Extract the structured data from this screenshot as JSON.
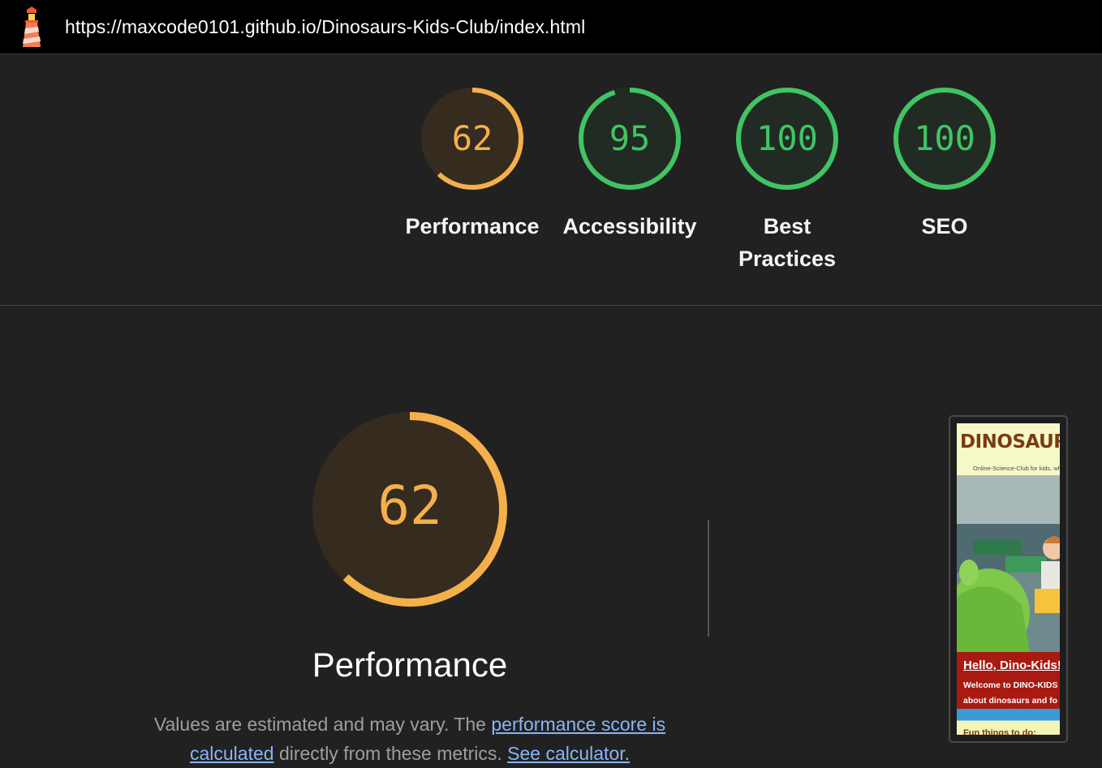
{
  "topbar": {
    "url": "https://maxcode0101.github.io/Dinosaurs-Kids-Club/index.html",
    "logo_icon": "lighthouse-icon"
  },
  "colors": {
    "average": "#f4b04a",
    "pass": "#41c464",
    "average_bg": "#352b1f",
    "pass_bg": "#212b24"
  },
  "categories": [
    {
      "label": "Performance",
      "score": 62,
      "status": "average"
    },
    {
      "label": "Accessibility",
      "score": 95,
      "status": "pass"
    },
    {
      "label": "Best Practices",
      "score": 100,
      "status": "pass"
    },
    {
      "label": "SEO",
      "score": 100,
      "status": "pass"
    }
  ],
  "performance_section": {
    "score": 62,
    "title": "Performance",
    "desc_prefix": "Values are estimated and may vary. The ",
    "link_score": "performance score is calculated",
    "desc_middle": " directly from these metrics. ",
    "link_calculator": "See calculator."
  },
  "screenshot": {
    "title": "DINOSAURS",
    "subtitle": "Online-Science-Club for kids, who",
    "hello": "Hello, Dino-Kids!",
    "welcome_line1": "Welcome to DINO-KIDS",
    "welcome_line2": "about dinosaurs and fo",
    "fun": "Fun things to do:"
  }
}
